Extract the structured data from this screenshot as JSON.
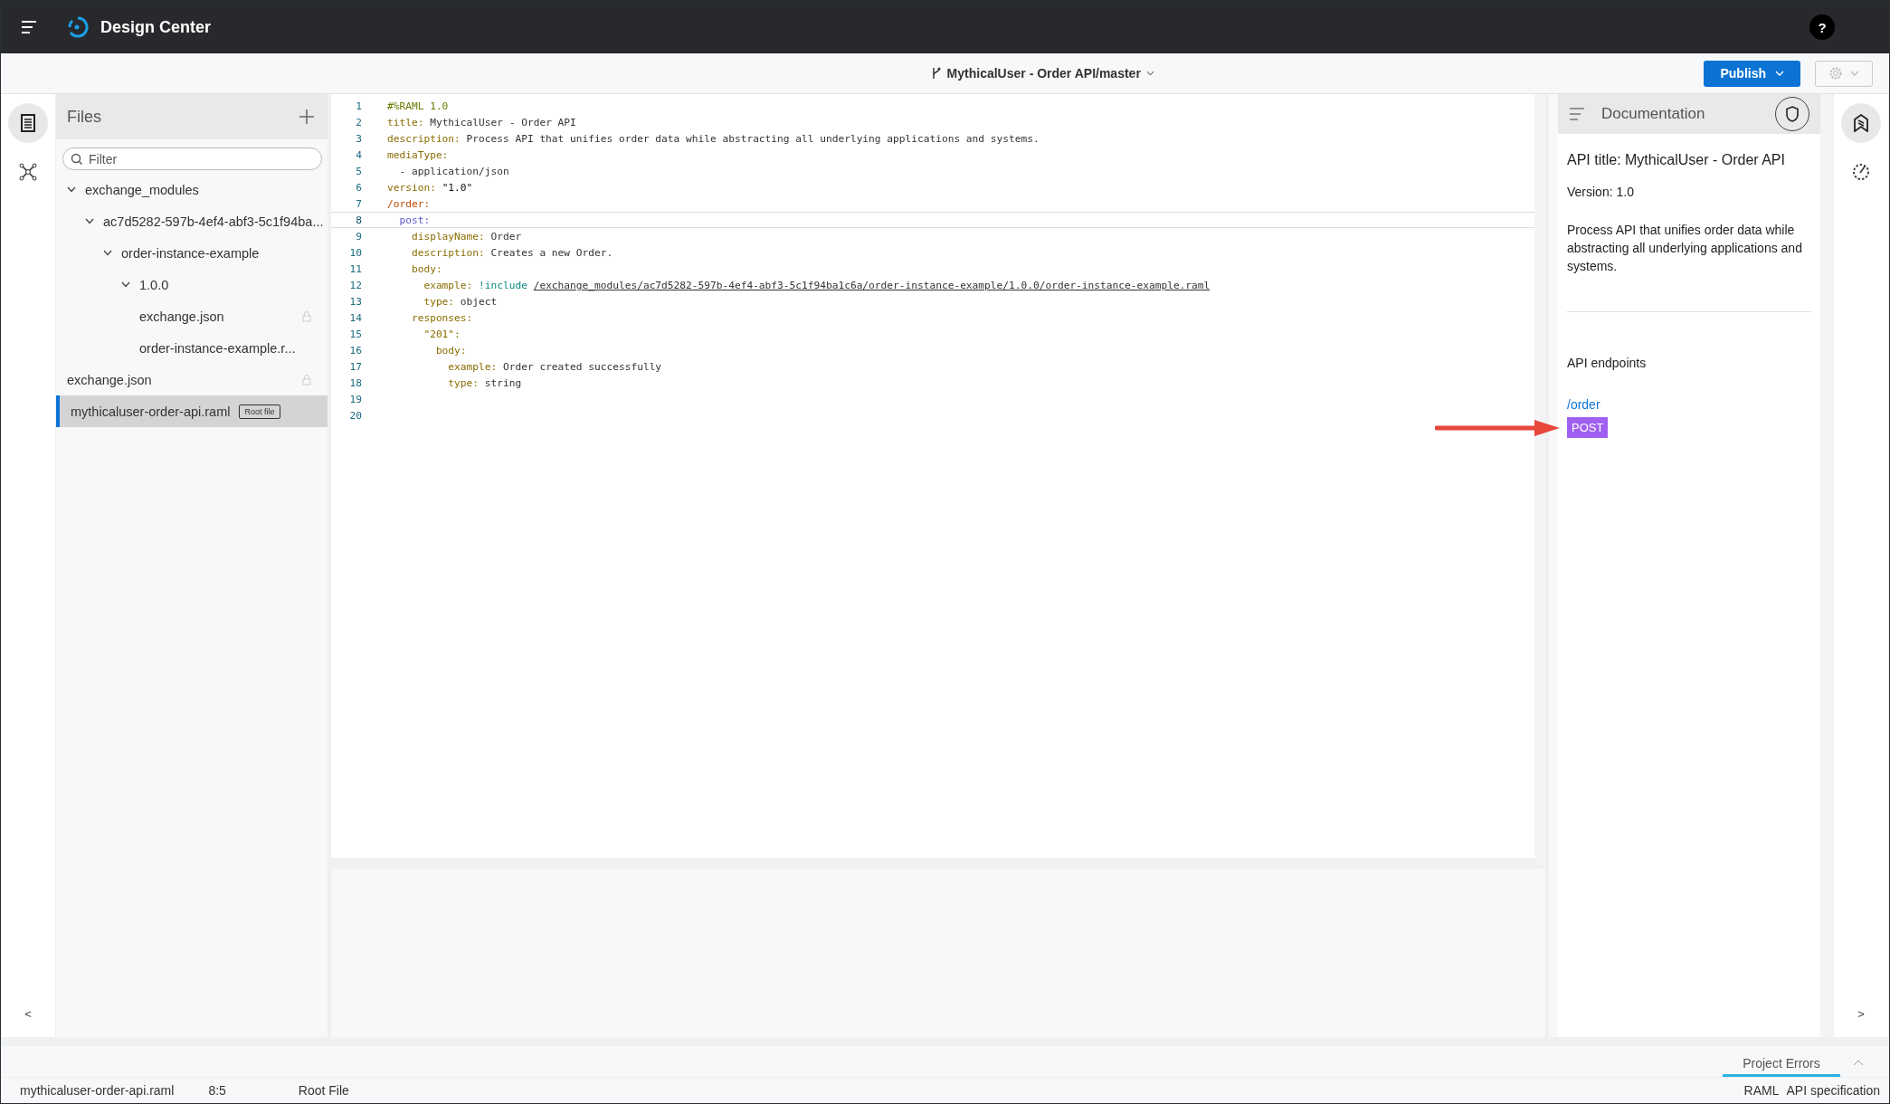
{
  "app": {
    "title": "Design Center",
    "help": "?"
  },
  "project": {
    "branch": "MythicalUser - Order API/master",
    "publish": "Publish"
  },
  "files": {
    "title": "Files",
    "filter_placeholder": "Filter",
    "tree": [
      {
        "name": "exchange_modules",
        "expanded": true,
        "children": [
          {
            "name": "ac7d5282-597b-4ef4-abf3-5c1f94ba...",
            "expanded": true,
            "children": [
              {
                "name": "order-instance-example",
                "expanded": true,
                "children": [
                  {
                    "name": "1.0.0",
                    "expanded": true,
                    "children": [
                      {
                        "name": "exchange.json",
                        "locked": true,
                        "selected": false
                      },
                      {
                        "name": "order-instance-example.r...",
                        "locked": false,
                        "selected": false
                      }
                    ]
                  }
                ]
              }
            ]
          }
        ]
      },
      {
        "name": "exchange.json",
        "locked": true,
        "selected": false
      },
      {
        "name": "mythicaluser-order-api.raml",
        "locked": false,
        "selected": true,
        "badge": "Root file"
      }
    ]
  },
  "editor": {
    "lines": [
      {
        "number": "1",
        "current": false,
        "tokens": [
          {
            "kind": "comment",
            "text": "#%RAML 1.0"
          }
        ]
      },
      {
        "number": "2",
        "current": false,
        "tokens": [
          {
            "kind": "key",
            "text": "title:"
          },
          {
            "kind": "text",
            "text": " MythicalUser - Order API"
          }
        ]
      },
      {
        "number": "3",
        "current": false,
        "tokens": [
          {
            "kind": "key",
            "text": "description:"
          },
          {
            "kind": "text",
            "text": " Process API that unifies order data while abstracting all underlying applications and systems."
          }
        ]
      },
      {
        "number": "4",
        "current": false,
        "tokens": [
          {
            "kind": "key",
            "text": "mediaType:"
          }
        ]
      },
      {
        "number": "5",
        "current": false,
        "tokens": [
          {
            "kind": "text",
            "text": "  - application/json"
          }
        ]
      },
      {
        "number": "6",
        "current": false,
        "tokens": [
          {
            "kind": "key",
            "text": "version:"
          },
          {
            "kind": "string",
            "text": " \"1.0\""
          }
        ]
      },
      {
        "number": "7",
        "current": false,
        "tokens": [
          {
            "kind": "resource",
            "text": "/order:"
          }
        ]
      },
      {
        "number": "8",
        "current": true,
        "tokens": [
          {
            "kind": "method",
            "text": "  post:"
          }
        ]
      },
      {
        "number": "9",
        "current": false,
        "tokens": [
          {
            "kind": "key",
            "text": "    displayName:"
          },
          {
            "kind": "text",
            "text": " Order"
          }
        ]
      },
      {
        "number": "10",
        "current": false,
        "tokens": [
          {
            "kind": "key",
            "text": "    description:"
          },
          {
            "kind": "text",
            "text": " Creates a new Order."
          }
        ]
      },
      {
        "number": "11",
        "current": false,
        "tokens": [
          {
            "kind": "key",
            "text": "    body:"
          }
        ]
      },
      {
        "number": "12",
        "current": false,
        "tokens": [
          {
            "kind": "key",
            "text": "      example:"
          },
          {
            "kind": "include",
            "text": " !include "
          },
          {
            "kind": "path",
            "text": "/exchange_modules/ac7d5282-597b-4ef4-abf3-5c1f94ba1c6a/order-instance-example/1.0.0/order-instance-example.raml"
          }
        ]
      },
      {
        "number": "13",
        "current": false,
        "tokens": [
          {
            "kind": "key",
            "text": "      type:"
          },
          {
            "kind": "text",
            "text": " object"
          }
        ]
      },
      {
        "number": "14",
        "current": false,
        "tokens": [
          {
            "kind": "key",
            "text": "    responses:"
          }
        ]
      },
      {
        "number": "15",
        "current": false,
        "tokens": [
          {
            "kind": "key",
            "text": "      \"201\":"
          }
        ]
      },
      {
        "number": "16",
        "current": false,
        "tokens": [
          {
            "kind": "key",
            "text": "        body:"
          }
        ]
      },
      {
        "number": "17",
        "current": false,
        "tokens": [
          {
            "kind": "key",
            "text": "          example:"
          },
          {
            "kind": "text",
            "text": " Order created successfully"
          }
        ]
      },
      {
        "number": "18",
        "current": false,
        "tokens": [
          {
            "kind": "key",
            "text": "          type:"
          },
          {
            "kind": "text",
            "text": " string"
          }
        ]
      },
      {
        "number": "19",
        "current": false
      },
      {
        "number": "20",
        "current": false
      }
    ]
  },
  "documentation": {
    "title": "Documentation",
    "api_title": "API title: MythicalUser - Order API",
    "version": "Version: 1.0",
    "description": "Process API that unifies order data while abstracting all underlying applications and systems.",
    "endpoints_title": "API endpoints",
    "endpoints": [
      {
        "path": "/order",
        "methods": [
          "POST"
        ]
      }
    ]
  },
  "left_rail": {
    "collapse": "<"
  },
  "right_rail": {
    "expand": ">"
  },
  "errors_panel": {
    "tab": "Project Errors"
  },
  "status_bar": {
    "file": "mythicaluser-order-api.raml",
    "position": "8:5",
    "role": "Root File",
    "language": "RAML",
    "type": "API specification"
  }
}
